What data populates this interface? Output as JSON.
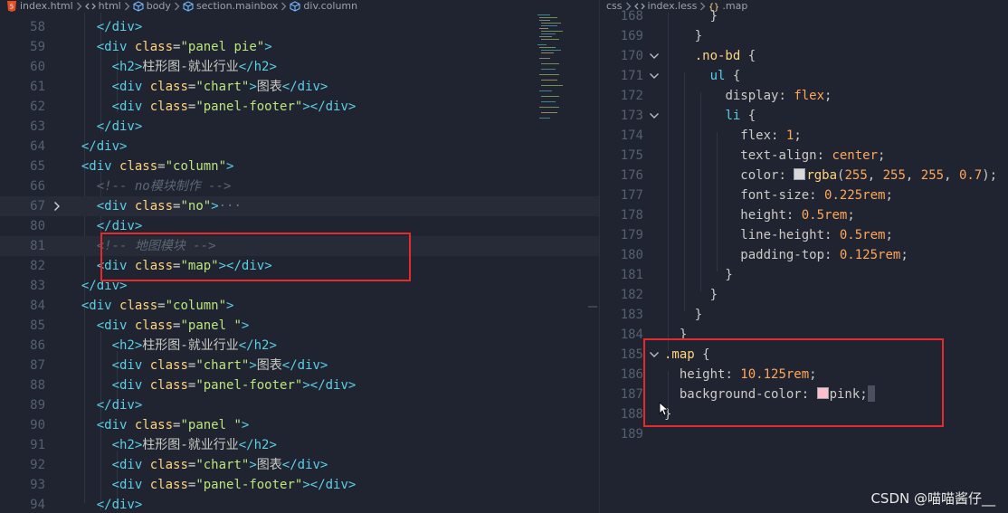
{
  "colors": {
    "background": "#1f2430",
    "line_number": "#56606e",
    "tag": "#5ccfe6",
    "attribute": "#ffd580",
    "string": "#bae67e",
    "comment": "#5c6773",
    "value": "#ffa759",
    "annotation_box": "#e62a2a"
  },
  "left_breadcrumb": {
    "items": [
      {
        "icon": "html5-icon",
        "label": "index.html"
      },
      {
        "icon": "code-bracket-icon",
        "label": "html"
      },
      {
        "icon": "cube-icon",
        "label": "body"
      },
      {
        "icon": "cube-icon",
        "label": "section.mainbox"
      },
      {
        "icon": "cube-icon",
        "label": "div.column"
      }
    ]
  },
  "right_breadcrumb": {
    "items": [
      {
        "icon": "",
        "label": "css"
      },
      {
        "icon": "code-bracket-icon",
        "label": "index.less"
      },
      {
        "icon": "selector-icon",
        "label": ".map"
      }
    ]
  },
  "left_editor": {
    "line_numbers": [
      "58",
      "59",
      "60",
      "61",
      "62",
      "63",
      "64",
      "65",
      "66",
      "67",
      "80",
      "81",
      "82",
      "83",
      "84",
      "85",
      "86",
      "87",
      "88",
      "89",
      "90",
      "91",
      "92",
      "93",
      "94"
    ],
    "lines": [
      [
        {
          "t": "    "
        },
        {
          "t": "</div>",
          "k": "tag"
        }
      ],
      [
        {
          "t": "    "
        },
        {
          "t": "<div ",
          "k": "tag"
        },
        {
          "t": "class",
          "k": "att"
        },
        {
          "t": "=",
          "k": "txt"
        },
        {
          "t": "\"panel pie\"",
          "k": "str"
        },
        {
          "t": ">",
          "k": "tag"
        }
      ],
      [
        {
          "t": "      "
        },
        {
          "t": "<h2>",
          "k": "tag"
        },
        {
          "t": "柱形图-就业行业",
          "k": "txt"
        },
        {
          "t": "</h2>",
          "k": "tag"
        }
      ],
      [
        {
          "t": "      "
        },
        {
          "t": "<div ",
          "k": "tag"
        },
        {
          "t": "class",
          "k": "att"
        },
        {
          "t": "=",
          "k": "txt"
        },
        {
          "t": "\"chart\"",
          "k": "str"
        },
        {
          "t": ">",
          "k": "tag"
        },
        {
          "t": "图表",
          "k": "txt"
        },
        {
          "t": "</div>",
          "k": "tag"
        }
      ],
      [
        {
          "t": "      "
        },
        {
          "t": "<div ",
          "k": "tag"
        },
        {
          "t": "class",
          "k": "att"
        },
        {
          "t": "=",
          "k": "txt"
        },
        {
          "t": "\"panel-footer\"",
          "k": "str"
        },
        {
          "t": "></div>",
          "k": "tag"
        }
      ],
      [
        {
          "t": "    "
        },
        {
          "t": "</div>",
          "k": "tag"
        }
      ],
      [
        {
          "t": "  "
        },
        {
          "t": "</div>",
          "k": "tag"
        }
      ],
      [
        {
          "t": "  "
        },
        {
          "t": "<div ",
          "k": "tag"
        },
        {
          "t": "class",
          "k": "att"
        },
        {
          "t": "=",
          "k": "txt"
        },
        {
          "t": "\"column\"",
          "k": "str"
        },
        {
          "t": ">",
          "k": "tag"
        }
      ],
      [
        {
          "t": "    "
        },
        {
          "t": "<!-- no模块制作 -->",
          "k": "com"
        }
      ],
      [
        {
          "t": "    "
        },
        {
          "t": "<div ",
          "k": "tag"
        },
        {
          "t": "class",
          "k": "att"
        },
        {
          "t": "=",
          "k": "txt"
        },
        {
          "t": "\"no\"",
          "k": "str"
        },
        {
          "t": ">",
          "k": "tag"
        },
        {
          "t": "···",
          "k": "fold"
        }
      ],
      [
        {
          "t": "    "
        },
        {
          "t": "</div>",
          "k": "tag"
        }
      ],
      [
        {
          "t": "    "
        },
        {
          "t": "<!-- 地图模块 -->",
          "k": "com"
        }
      ],
      [
        {
          "t": "    "
        },
        {
          "t": "<div ",
          "k": "tag"
        },
        {
          "t": "class",
          "k": "att"
        },
        {
          "t": "=",
          "k": "txt"
        },
        {
          "t": "\"map\"",
          "k": "str"
        },
        {
          "t": "></div>",
          "k": "tag"
        }
      ],
      [
        {
          "t": "  "
        },
        {
          "t": "</div>",
          "k": "tag"
        }
      ],
      [
        {
          "t": "  "
        },
        {
          "t": "<div ",
          "k": "tag"
        },
        {
          "t": "class",
          "k": "att"
        },
        {
          "t": "=",
          "k": "txt"
        },
        {
          "t": "\"column\"",
          "k": "str"
        },
        {
          "t": ">",
          "k": "tag"
        }
      ],
      [
        {
          "t": "    "
        },
        {
          "t": "<div ",
          "k": "tag"
        },
        {
          "t": "class",
          "k": "att"
        },
        {
          "t": "=",
          "k": "txt"
        },
        {
          "t": "\"panel \"",
          "k": "str"
        },
        {
          "t": ">",
          "k": "tag"
        }
      ],
      [
        {
          "t": "      "
        },
        {
          "t": "<h2>",
          "k": "tag"
        },
        {
          "t": "柱形图-就业行业",
          "k": "txt"
        },
        {
          "t": "</h2>",
          "k": "tag"
        }
      ],
      [
        {
          "t": "      "
        },
        {
          "t": "<div ",
          "k": "tag"
        },
        {
          "t": "class",
          "k": "att"
        },
        {
          "t": "=",
          "k": "txt"
        },
        {
          "t": "\"chart\"",
          "k": "str"
        },
        {
          "t": ">",
          "k": "tag"
        },
        {
          "t": "图表",
          "k": "txt"
        },
        {
          "t": "</div>",
          "k": "tag"
        }
      ],
      [
        {
          "t": "      "
        },
        {
          "t": "<div ",
          "k": "tag"
        },
        {
          "t": "class",
          "k": "att"
        },
        {
          "t": "=",
          "k": "txt"
        },
        {
          "t": "\"panel-footer\"",
          "k": "str"
        },
        {
          "t": "></div>",
          "k": "tag"
        }
      ],
      [
        {
          "t": "    "
        },
        {
          "t": "</div>",
          "k": "tag"
        }
      ],
      [
        {
          "t": "    "
        },
        {
          "t": "<div ",
          "k": "tag"
        },
        {
          "t": "class",
          "k": "att"
        },
        {
          "t": "=",
          "k": "txt"
        },
        {
          "t": "\"panel \"",
          "k": "str"
        },
        {
          "t": ">",
          "k": "tag"
        }
      ],
      [
        {
          "t": "      "
        },
        {
          "t": "<h2>",
          "k": "tag"
        },
        {
          "t": "柱形图-就业行业",
          "k": "txt"
        },
        {
          "t": "</h2>",
          "k": "tag"
        }
      ],
      [
        {
          "t": "      "
        },
        {
          "t": "<div ",
          "k": "tag"
        },
        {
          "t": "class",
          "k": "att"
        },
        {
          "t": "=",
          "k": "txt"
        },
        {
          "t": "\"chart\"",
          "k": "str"
        },
        {
          "t": ">",
          "k": "tag"
        },
        {
          "t": "图表",
          "k": "txt"
        },
        {
          "t": "</div>",
          "k": "tag"
        }
      ],
      [
        {
          "t": "      "
        },
        {
          "t": "<div ",
          "k": "tag"
        },
        {
          "t": "class",
          "k": "att"
        },
        {
          "t": "=",
          "k": "txt"
        },
        {
          "t": "\"panel-footer\"",
          "k": "str"
        },
        {
          "t": "></div>",
          "k": "tag"
        }
      ],
      [
        {
          "t": "    "
        },
        {
          "t": "</div>",
          "k": "tag"
        }
      ]
    ]
  },
  "right_editor": {
    "line_numbers": [
      "168",
      "169",
      "170",
      "171",
      "172",
      "173",
      "174",
      "175",
      "176",
      "177",
      "178",
      "179",
      "180",
      "181",
      "182",
      "183",
      "184",
      "185",
      "186",
      "187",
      "188",
      "189"
    ],
    "lines": [
      [
        {
          "t": "      }",
          "k": "pun"
        }
      ],
      [
        {
          "t": "    }",
          "k": "pun"
        }
      ],
      [
        {
          "t": "    "
        },
        {
          "t": ".no-bd",
          "k": "sel"
        },
        {
          "t": " {",
          "k": "pun"
        }
      ],
      [
        {
          "t": "      "
        },
        {
          "t": "ul",
          "k": "tag"
        },
        {
          "t": " {",
          "k": "pun"
        }
      ],
      [
        {
          "t": "        "
        },
        {
          "t": "display",
          "k": "prop"
        },
        {
          "t": ": ",
          "k": "pun"
        },
        {
          "t": "flex",
          "k": "val"
        },
        {
          "t": ";",
          "k": "pun"
        }
      ],
      [
        {
          "t": "        "
        },
        {
          "t": "li",
          "k": "tag"
        },
        {
          "t": " {",
          "k": "pun"
        }
      ],
      [
        {
          "t": "          "
        },
        {
          "t": "flex",
          "k": "prop"
        },
        {
          "t": ": ",
          "k": "pun"
        },
        {
          "t": "1",
          "k": "val"
        },
        {
          "t": ";",
          "k": "pun"
        }
      ],
      [
        {
          "t": "          "
        },
        {
          "t": "text-align",
          "k": "prop"
        },
        {
          "t": ": ",
          "k": "pun"
        },
        {
          "t": "center",
          "k": "val"
        },
        {
          "t": ";",
          "k": "pun"
        }
      ],
      [
        {
          "t": "          "
        },
        {
          "t": "color",
          "k": "prop"
        },
        {
          "t": ": ",
          "k": "pun"
        },
        {
          "sw": "#d9d9d9"
        },
        {
          "t": "rgba",
          "k": "fn"
        },
        {
          "t": "(",
          "k": "pun"
        },
        {
          "t": "255",
          "k": "val"
        },
        {
          "t": ", ",
          "k": "pun"
        },
        {
          "t": "255",
          "k": "val"
        },
        {
          "t": ", ",
          "k": "pun"
        },
        {
          "t": "255",
          "k": "val"
        },
        {
          "t": ", ",
          "k": "pun"
        },
        {
          "t": "0.7",
          "k": "val"
        },
        {
          "t": ");",
          "k": "pun"
        }
      ],
      [
        {
          "t": "          "
        },
        {
          "t": "font-size",
          "k": "prop"
        },
        {
          "t": ": ",
          "k": "pun"
        },
        {
          "t": "0.225rem",
          "k": "val"
        },
        {
          "t": ";",
          "k": "pun"
        }
      ],
      [
        {
          "t": "          "
        },
        {
          "t": "height",
          "k": "prop"
        },
        {
          "t": ": ",
          "k": "pun"
        },
        {
          "t": "0.5rem",
          "k": "val"
        },
        {
          "t": ";",
          "k": "pun"
        }
      ],
      [
        {
          "t": "          "
        },
        {
          "t": "line-height",
          "k": "prop"
        },
        {
          "t": ": ",
          "k": "pun"
        },
        {
          "t": "0.5rem",
          "k": "val"
        },
        {
          "t": ";",
          "k": "pun"
        }
      ],
      [
        {
          "t": "          "
        },
        {
          "t": "padding-top",
          "k": "prop"
        },
        {
          "t": ": ",
          "k": "pun"
        },
        {
          "t": "0.125rem",
          "k": "val"
        },
        {
          "t": ";",
          "k": "pun"
        }
      ],
      [
        {
          "t": "        }",
          "k": "pun"
        }
      ],
      [
        {
          "t": "      }",
          "k": "pun"
        }
      ],
      [
        {
          "t": "    }",
          "k": "pun"
        }
      ],
      [
        {
          "t": "  }",
          "k": "pun"
        }
      ],
      [
        {
          "t": ".map",
          "k": "sel"
        },
        {
          "t": " {",
          "k": "pun"
        }
      ],
      [
        {
          "t": "  "
        },
        {
          "t": "height",
          "k": "prop"
        },
        {
          "t": ": ",
          "k": "pun"
        },
        {
          "t": "10.125rem",
          "k": "val"
        },
        {
          "t": ";",
          "k": "pun"
        }
      ],
      [
        {
          "t": "  "
        },
        {
          "t": "background-color",
          "k": "prop"
        },
        {
          "t": ": ",
          "k": "pun"
        },
        {
          "sw": "#ffc0cb"
        },
        {
          "t": "pink",
          "k": "prop"
        },
        {
          "t": ";",
          "k": "pun"
        },
        {
          "cursor": true
        }
      ],
      [
        {
          "t": "}",
          "k": "pun"
        }
      ],
      []
    ]
  },
  "watermark": "CSDN @喵喵酱仔__"
}
